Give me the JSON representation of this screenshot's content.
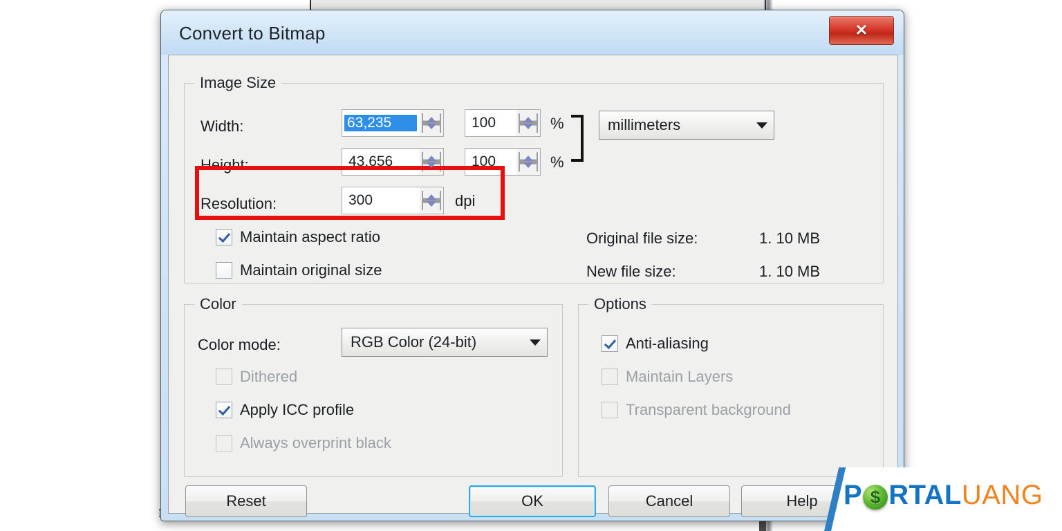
{
  "dialog": {
    "title": "Convert to Bitmap",
    "close_label": "✕"
  },
  "image_size": {
    "group_title": "Image Size",
    "width_label": "Width:",
    "width_value": "63,235",
    "width_percent": "100",
    "height_label": "Height:",
    "height_value": "43,656",
    "height_percent": "100",
    "percent_symbol": "%",
    "resolution_label": "Resolution:",
    "resolution_value": "300",
    "resolution_unit": "dpi",
    "units_selected": "millimeters",
    "maintain_aspect_ratio": {
      "label": "Maintain aspect ratio",
      "checked": true,
      "enabled": true
    },
    "maintain_original_size": {
      "label": "Maintain original size",
      "checked": false,
      "enabled": true
    },
    "original_file_size_label": "Original file size:",
    "original_file_size_value": "1. 10 MB",
    "new_file_size_label": "New file size:",
    "new_file_size_value": "1. 10 MB"
  },
  "color": {
    "group_title": "Color",
    "color_mode_label": "Color mode:",
    "color_mode_value": "RGB Color (24-bit)",
    "dithered": {
      "label": "Dithered",
      "checked": false,
      "enabled": false
    },
    "apply_icc": {
      "label": "Apply ICC profile",
      "checked": true,
      "enabled": true
    },
    "overprint_black": {
      "label": "Always overprint black",
      "checked": false,
      "enabled": false
    }
  },
  "options": {
    "group_title": "Options",
    "anti_aliasing": {
      "label": "Anti-aliasing",
      "checked": true,
      "enabled": true
    },
    "maintain_layers": {
      "label": "Maintain Layers",
      "checked": false,
      "enabled": false
    },
    "transparent_background": {
      "label": "Transparent background",
      "checked": false,
      "enabled": false
    }
  },
  "buttons": {
    "reset": "Reset",
    "ok": "OK",
    "cancel": "Cancel",
    "help": "Help"
  },
  "annotation": {
    "highlight_color": "#E8100F",
    "highlight_target": "Resolution"
  },
  "watermark": {
    "part_p": "P",
    "coin_glyph": "$",
    "part_rtal": "RTAL",
    "part_uang": "UANG"
  },
  "colors": {
    "titlebar_blue": "#CFE3F6",
    "close_red": "#D8392C",
    "selection_blue": "#2F8FE8",
    "default_button_focus": "#2FA8E0",
    "brand_blue": "#1573C4",
    "brand_orange": "#EF8420"
  }
}
